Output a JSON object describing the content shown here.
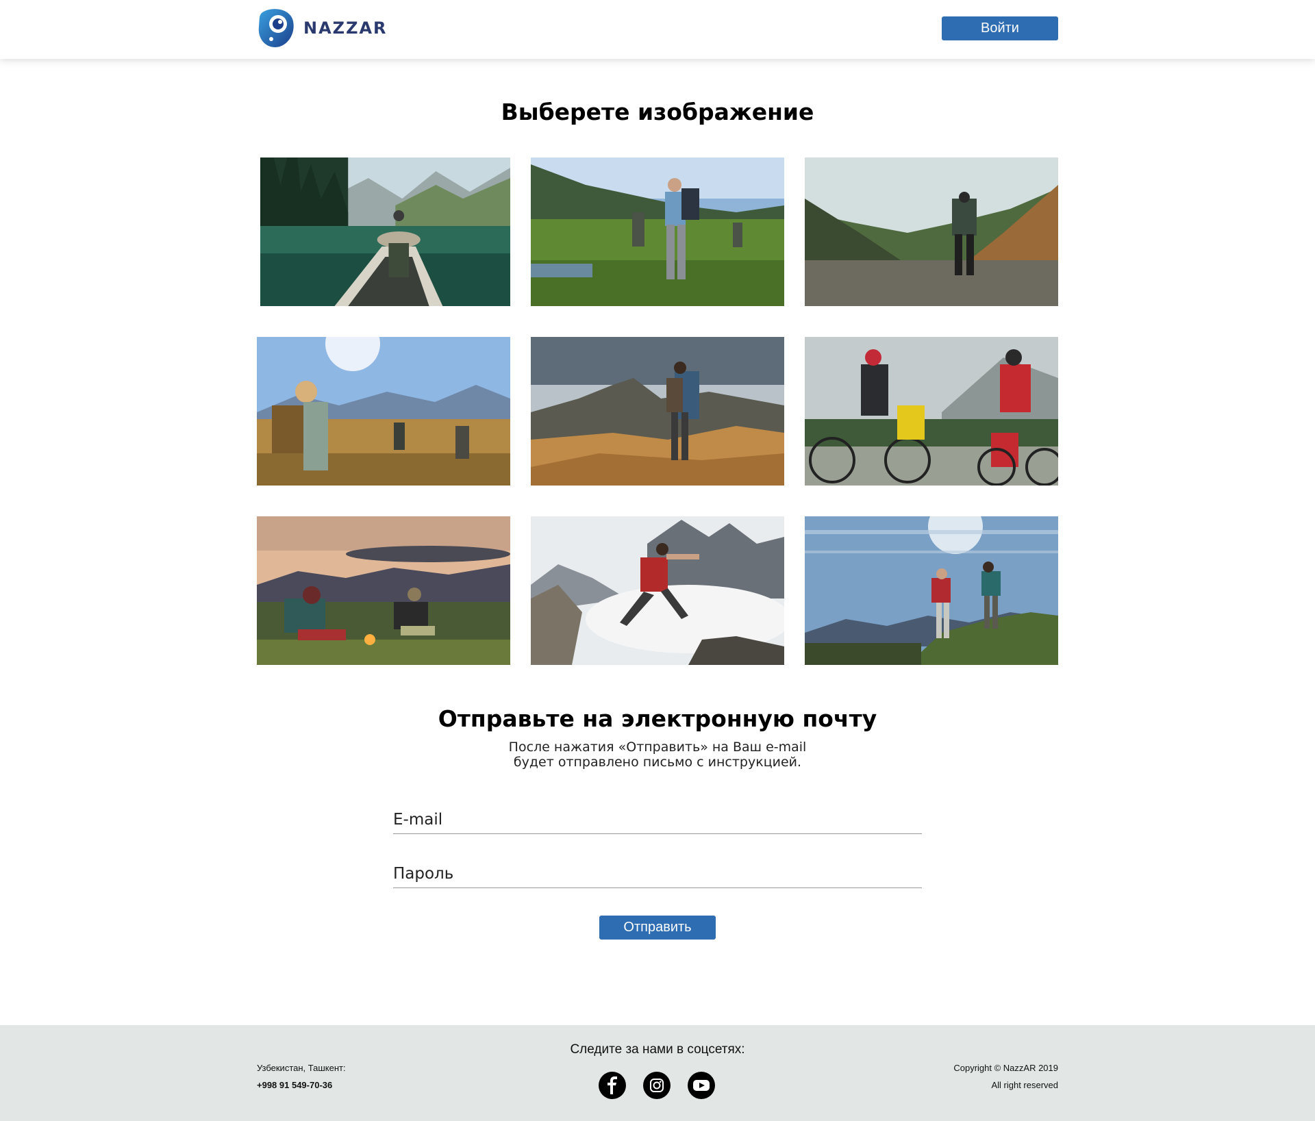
{
  "header": {
    "logo_text": "NAZZAR",
    "login_label": "Войти"
  },
  "gallery": {
    "title": "Выберете изображение",
    "images": [
      {
        "alt": "canoe-lake-mountains"
      },
      {
        "alt": "hikers-meadow"
      },
      {
        "alt": "hiker-valley"
      },
      {
        "alt": "hikers-sunlit-hill"
      },
      {
        "alt": "hiker-rocky-ridge"
      },
      {
        "alt": "cyclists-touring"
      },
      {
        "alt": "campfire-dusk"
      },
      {
        "alt": "hiker-jumping-rocks"
      },
      {
        "alt": "hikers-blue-sky"
      }
    ]
  },
  "email_form": {
    "title": "Отправьте на электронную почту",
    "subtitle_line1": "После нажатия «Отправить» на Ваш e-mail",
    "subtitle_line2": "будет отправлено письмо с инструкцией.",
    "email_placeholder": "E-mail",
    "password_placeholder": "Пароль",
    "submit_label": "Отправить"
  },
  "footer": {
    "location": "Узбекистан, Ташкент:",
    "phone": "+998 91 549-70-36",
    "follow_text": "Следите за нами в соцсетях:",
    "copyright": "Copyright © NazzAR 2019",
    "rights": "All right reserved",
    "socials": [
      "facebook-icon",
      "instagram-icon",
      "youtube-icon"
    ]
  },
  "colors": {
    "accent": "#2e6db2",
    "footer_bg": "#e2e7e6",
    "logo_text": "#2b3a6e"
  }
}
